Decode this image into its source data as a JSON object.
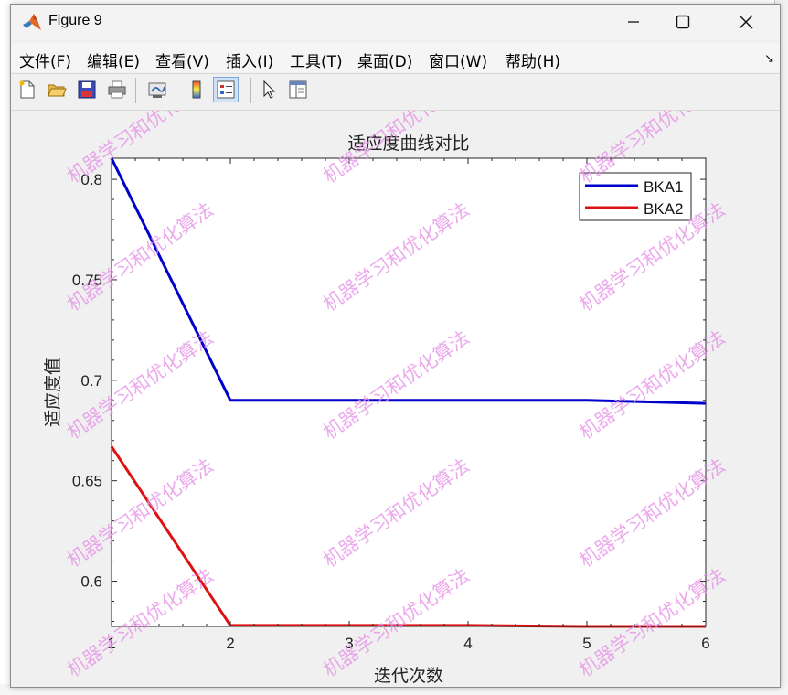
{
  "window": {
    "title": "Figure 9"
  },
  "menu": {
    "items": [
      "文件(F)",
      "编辑(E)",
      "查看(V)",
      "插入(I)",
      "工具(T)",
      "桌面(D)",
      "窗口(W)",
      "帮助(H)"
    ]
  },
  "toolbar": {
    "icons": [
      "new-figure-icon",
      "open-file-icon",
      "save-icon",
      "print-icon",
      "link-plot-icon",
      "colorbar-icon",
      "legend-icon",
      "pointer-icon",
      "property-inspector-icon"
    ]
  },
  "colors": {
    "bka1": "#0000cc",
    "bka2": "#dd1111",
    "watermark": "#e58ee5"
  },
  "watermark": {
    "text": "机器学习和优化算法"
  },
  "chart_data": {
    "type": "line",
    "title": "适应度曲线对比",
    "xlabel": "迭代次数",
    "ylabel": "适应度值",
    "x": [
      1,
      2,
      3,
      4,
      5,
      6
    ],
    "xlim": [
      1,
      6
    ],
    "ylim": [
      0.5775,
      0.8105
    ],
    "xticks": [
      "1",
      "2",
      "3",
      "4",
      "5",
      "6"
    ],
    "yticks": [
      "0.6",
      "0.65",
      "0.7",
      "0.75",
      "0.8"
    ],
    "ytick_values": [
      0.6,
      0.65,
      0.7,
      0.75,
      0.8
    ],
    "grid": false,
    "legend_position": "top-right",
    "series": [
      {
        "name": "BKA1",
        "values": [
          0.8105,
          0.69,
          0.69,
          0.69,
          0.69,
          0.6885
        ]
      },
      {
        "name": "BKA2",
        "values": [
          0.667,
          0.578,
          0.578,
          0.578,
          0.5775,
          0.5775
        ]
      }
    ]
  }
}
